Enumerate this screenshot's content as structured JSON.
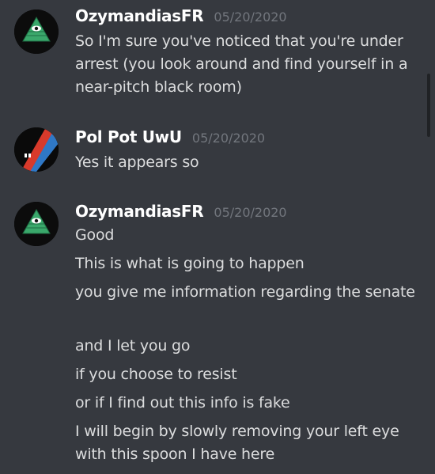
{
  "messages": [
    {
      "author": "OzymandiasFR",
      "timestamp": "05/20/2020",
      "avatar_icon": "illuminati-eye-icon",
      "lines": [
        "So I'm sure you've noticed that you're under arrest (you look around and find yourself in a near-pitch black room)"
      ]
    },
    {
      "author": "Pol Pot UwU",
      "timestamp": "05/20/2020",
      "avatar_icon": "red-blue-diagonal-avatar-icon",
      "lines": [
        "Yes it appears so"
      ]
    },
    {
      "author": "OzymandiasFR",
      "timestamp": "05/20/2020",
      "avatar_icon": "illuminati-eye-icon",
      "lines": [
        "Good",
        "This is what is going to happen",
        "you give me information regarding the senate",
        "and I let you go",
        "if you choose to resist",
        "or if I find out this info is fake",
        "I will begin by slowly removing your left eye with this spoon I have here"
      ]
    }
  ],
  "colors": {
    "background": "#36393f",
    "username": "#ffffff",
    "timestamp": "#72767d",
    "message_text": "#dcddde",
    "scrollbar": "#202225"
  }
}
